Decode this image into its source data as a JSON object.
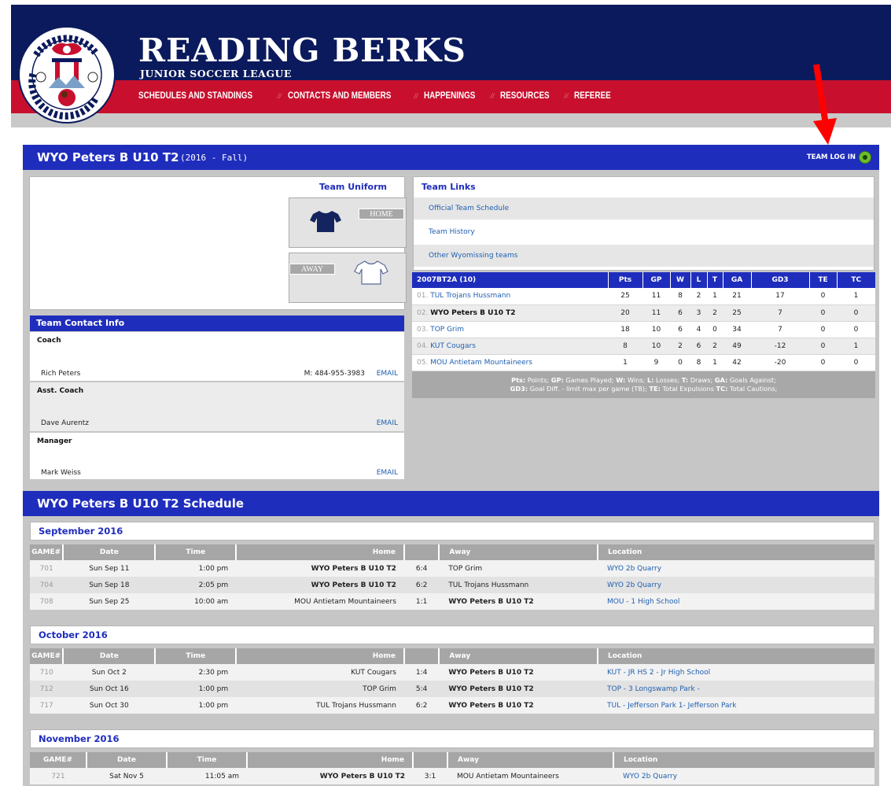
{
  "header": {
    "title": "READING BERKS",
    "subtitle": "JUNIOR SOCCER LEAGUE",
    "logo_text": "Reading Berks Junior Soccer League",
    "nav": [
      "SCHEDULES AND STANDINGS",
      "CONTACTS AND MEMBERS",
      "HAPPENINGS",
      "RESOURCES",
      "REFEREE"
    ],
    "nav_separator": "//"
  },
  "team": {
    "name": "WYO Peters B U10 T2",
    "season": "(2016 - Fall)",
    "login_label": "TEAM LOG IN"
  },
  "uniform": {
    "title": "Team Uniform",
    "home_label": "HOME",
    "away_label": "AWAY",
    "home_color": "#14245e",
    "away_color": "#ffffff"
  },
  "contacts": {
    "title": "Team Contact Info",
    "items": [
      {
        "role": "Coach",
        "name": "Rich Peters",
        "phone": "M: 484-955-3983",
        "email": "EMAIL"
      },
      {
        "role": "Asst. Coach",
        "name": "Dave Aurentz",
        "phone": "",
        "email": "EMAIL"
      },
      {
        "role": "Manager",
        "name": "Mark Weiss",
        "phone": "",
        "email": "EMAIL"
      }
    ]
  },
  "links": {
    "title": "Team Links",
    "items": [
      "Official Team Schedule",
      "Team History",
      "Other Wyomissing teams"
    ]
  },
  "standings": {
    "division": "2007BT2A (10)",
    "columns": [
      "Pts",
      "GP",
      "W",
      "L",
      "T",
      "GA",
      "GD3",
      "TE",
      "TC"
    ],
    "rows": [
      {
        "rank": "01.",
        "team": "TUL Trojans Hussmann",
        "stats": [
          "25",
          "11",
          "8",
          "2",
          "1",
          "21",
          "17",
          "0",
          "1"
        ]
      },
      {
        "rank": "02.",
        "team": "WYO Peters B U10 T2",
        "stats": [
          "20",
          "11",
          "6",
          "3",
          "2",
          "25",
          "7",
          "0",
          "0"
        ]
      },
      {
        "rank": "03.",
        "team": "TOP Grim",
        "stats": [
          "18",
          "10",
          "6",
          "4",
          "0",
          "34",
          "7",
          "0",
          "0"
        ]
      },
      {
        "rank": "04.",
        "team": "KUT Cougars",
        "stats": [
          "8",
          "10",
          "2",
          "6",
          "2",
          "49",
          "-12",
          "0",
          "1"
        ]
      },
      {
        "rank": "05.",
        "team": "MOU Antietam Mountaineers",
        "stats": [
          "1",
          "9",
          "0",
          "8",
          "1",
          "42",
          "-20",
          "0",
          "0"
        ]
      }
    ],
    "legend_line1": [
      [
        "Pts:",
        " Points; "
      ],
      [
        "GP:",
        " Games Played; "
      ],
      [
        "W:",
        " Wins; "
      ],
      [
        "L:",
        " Losses; "
      ],
      [
        "T:",
        " Draws; "
      ],
      [
        "GA:",
        " Goals Against;"
      ]
    ],
    "legend_line2": [
      [
        "GD3:",
        " Goal Diff. - limit max per game (TB); "
      ],
      [
        "TE:",
        " Total Expulsions "
      ],
      [
        "TC:",
        " Total Cautions;"
      ]
    ]
  },
  "schedule": {
    "title": "WYO Peters B U10 T2 Schedule",
    "columns": [
      "GAME#",
      "Date",
      "Time",
      "Home",
      "",
      "Away",
      "Location"
    ],
    "months": [
      {
        "name": "September 2016",
        "games": [
          {
            "game": "701",
            "date": "Sun Sep 11",
            "time": "1:00 pm",
            "home": "WYO Peters B U10 T2",
            "score": "6:4",
            "away": "TOP Grim",
            "location": "WYO 2b Quarry"
          },
          {
            "game": "704",
            "date": "Sun Sep 18",
            "time": "2:05 pm",
            "home": "WYO Peters B U10 T2",
            "score": "6:2",
            "away": "TUL Trojans Hussmann",
            "location": "WYO 2b Quarry"
          },
          {
            "game": "708",
            "date": "Sun Sep 25",
            "time": "10:00 am",
            "home": "MOU Antietam Mountaineers",
            "score": "1:1",
            "away": "WYO Peters B U10 T2",
            "location": "MOU - 1 High School"
          }
        ]
      },
      {
        "name": "October 2016",
        "games": [
          {
            "game": "710",
            "date": "Sun Oct 2",
            "time": "2:30 pm",
            "home": "KUT Cougars",
            "score": "1:4",
            "away": "WYO Peters B U10 T2",
            "location": "KUT - JR HS 2 - Jr High School"
          },
          {
            "game": "712",
            "date": "Sun Oct 16",
            "time": "1:00 pm",
            "home": "TOP Grim",
            "score": "5:4",
            "away": "WYO Peters B U10 T2",
            "location": "TOP - 3 Longswamp Park -"
          },
          {
            "game": "717",
            "date": "Sun Oct 30",
            "time": "1:00 pm",
            "home": "TUL Trojans Hussmann",
            "score": "6:2",
            "away": "WYO Peters B U10 T2",
            "location": "TUL - Jefferson Park 1- Jefferson Park"
          }
        ]
      },
      {
        "name": "November 2016",
        "games": [
          {
            "game": "721",
            "date": "Sat Nov 5",
            "time": "11:05 am",
            "home": "WYO Peters B U10 T2",
            "score": "3:1",
            "away": "MOU Antietam Mountaineers",
            "location": "WYO 2b Quarry"
          }
        ]
      }
    ]
  }
}
